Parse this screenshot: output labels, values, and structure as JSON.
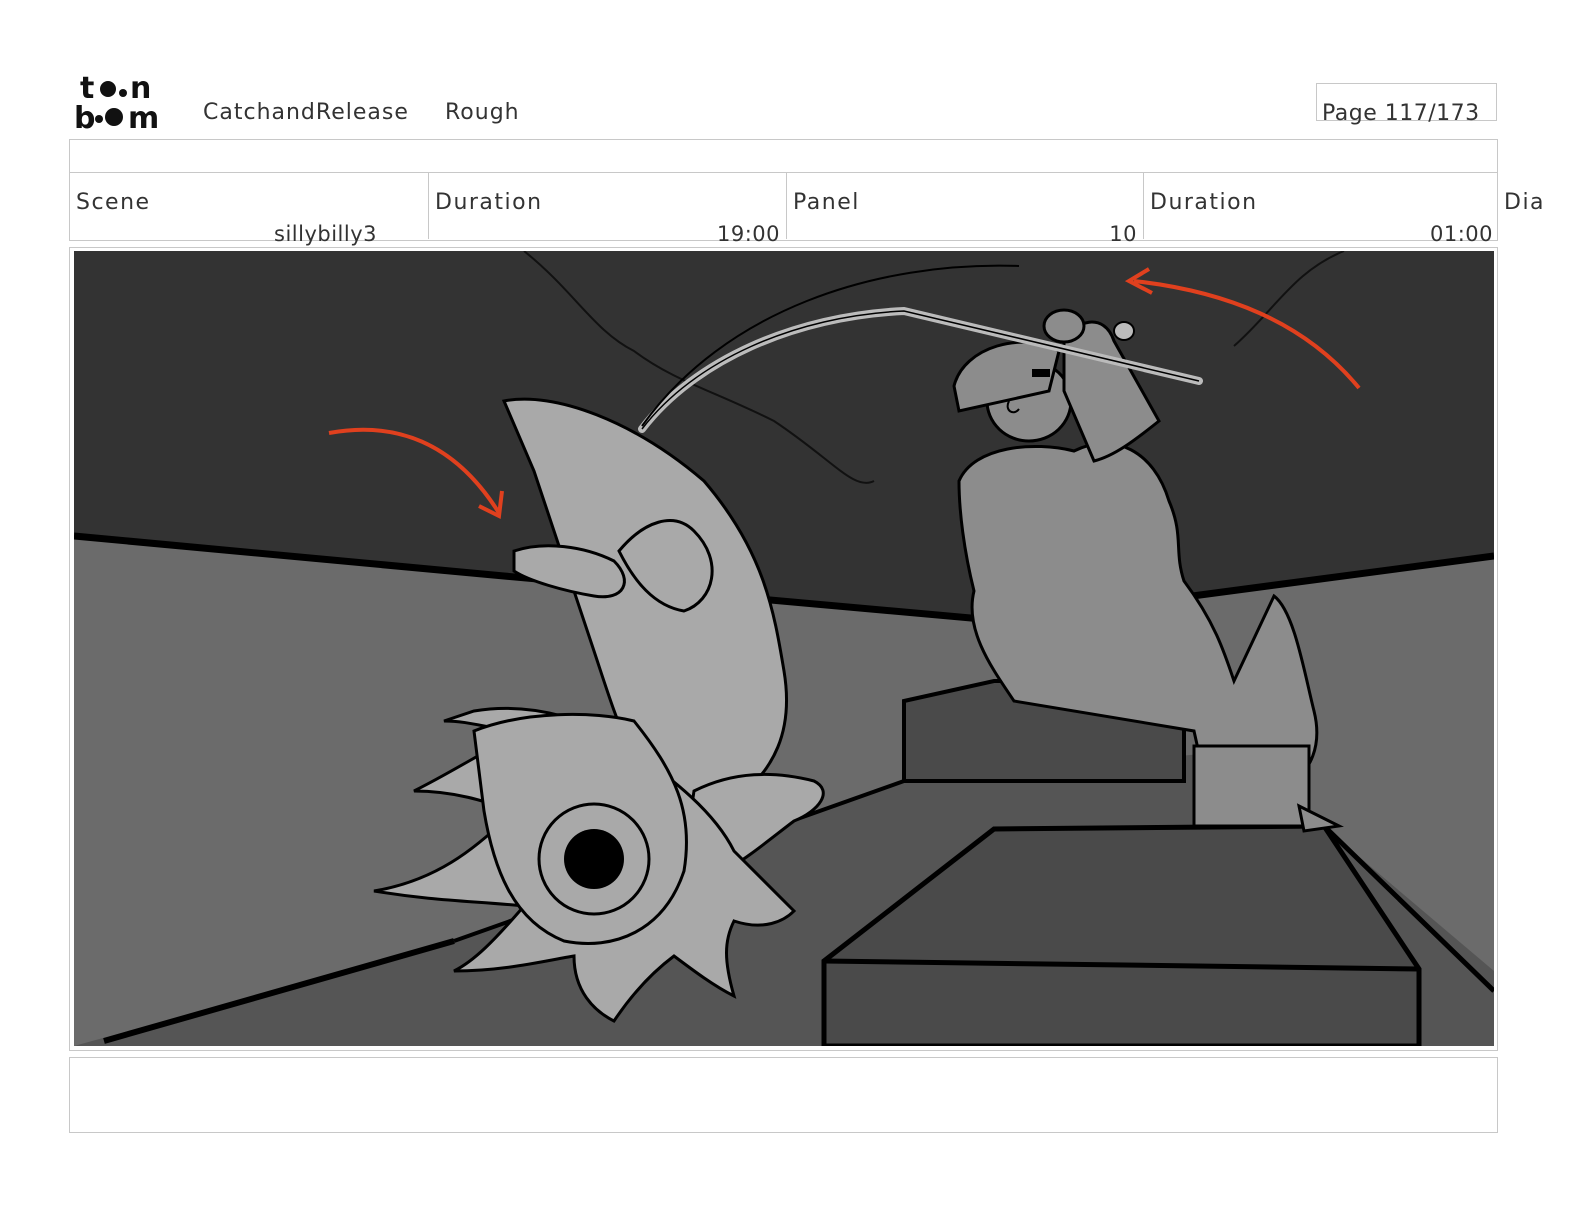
{
  "header": {
    "logo_text": "toon boom",
    "project": "CatchandRelease",
    "stage": "Rough",
    "page": "Page 117/173"
  },
  "info": {
    "scene_label": "Scene",
    "scene_value": "sillybilly3",
    "scene_duration_label": "Duration",
    "scene_duration_value": "19:00",
    "panel_label": "Panel",
    "panel_value": "10",
    "panel_duration_label": "Duration",
    "panel_duration_value": "01:00",
    "dialogue_label": "Dia"
  },
  "colors": {
    "sky": "#333333",
    "floor": "#6b6b6b",
    "figure": "#a9a9a9",
    "fisherman": "#8c8c8c",
    "box": "#4a4a4a",
    "arrow": "#e0401e"
  },
  "panel_image": {
    "icon": "storyboard-sketch"
  },
  "notes": {
    "text": ""
  }
}
